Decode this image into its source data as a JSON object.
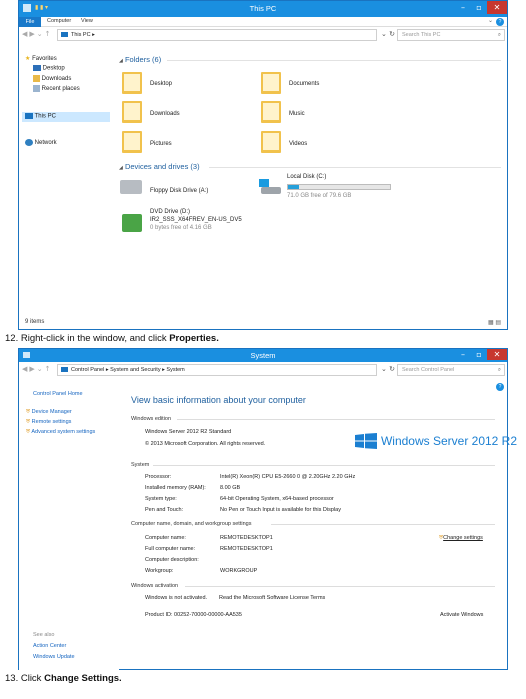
{
  "explorer": {
    "title": "This PC",
    "ribbon_tabs": [
      "File",
      "Computer",
      "View"
    ],
    "address": "This PC ▸",
    "search_placeholder": "Search This PC",
    "nav": {
      "favorites": "Favorites",
      "desktop": "Desktop",
      "downloads": "Downloads",
      "recent": "Recent places",
      "thispc": "This PC",
      "network": "Network"
    },
    "folders_header": "Folders (6)",
    "folders": [
      "Desktop",
      "Documents",
      "Downloads",
      "Music",
      "Pictures",
      "Videos"
    ],
    "devices_header": "Devices and drives (3)",
    "floppy": "Floppy Disk Drive (A:)",
    "localdisk": "Local Disk (C:)",
    "localdisk_free": "71.0 GB free of 79.6 GB",
    "localdisk_used_fraction": 0.11,
    "dvd_name": "DVD Drive (D:)",
    "dvd_label": "IR2_SSS_X64FREV_EN-US_DV5",
    "dvd_free": "0 bytes free of 4.16 GB",
    "status": "9 items"
  },
  "step12": {
    "prefix": "12. Right-click in the window, and click ",
    "bold": "Properties."
  },
  "step13": {
    "prefix": "13. Click ",
    "bold": "Change Settings."
  },
  "system": {
    "title": "System",
    "address": "Control Panel ▸ System and Security ▸ System",
    "search_placeholder": "Search Control Panel",
    "side": {
      "home": "Control Panel Home",
      "device_manager": "Device Manager",
      "remote": "Remote settings",
      "advanced": "Advanced system settings",
      "see_also": "See also",
      "action_center": "Action Center",
      "windows_update": "Windows Update"
    },
    "heading": "View basic information about your computer",
    "edition_header": "Windows edition",
    "edition": "Windows Server 2012 R2 Standard",
    "copyright": "© 2013 Microsoft Corporation. All rights reserved.",
    "logo_text": "Windows Server 2012 R2",
    "system_header": "System",
    "rows": [
      {
        "label": "Processor:",
        "value": "Intel(R) Xeon(R) CPU E5-2660 0 @ 2.20GHz  2.20 GHz"
      },
      {
        "label": "Installed memory (RAM):",
        "value": "8.00 GB"
      },
      {
        "label": "System type:",
        "value": "64-bit Operating System, x64-based processor"
      },
      {
        "label": "Pen and Touch:",
        "value": "No Pen or Touch Input is available for this Display"
      }
    ],
    "name_header": "Computer name, domain, and workgroup settings",
    "name_rows": [
      {
        "label": "Computer name:",
        "value": "REMOTEDESKTOP1"
      },
      {
        "label": "Full computer name:",
        "value": "REMOTEDESKTOP1"
      },
      {
        "label": "Computer description:",
        "value": ""
      },
      {
        "label": "Workgroup:",
        "value": "WORKGROUP"
      }
    ],
    "change_settings": "Change settings",
    "activation_header": "Windows activation",
    "activation_status": "Windows is not activated.",
    "license_link": "Read the Microsoft Software License Terms",
    "product_id": "Product ID: 00252-70000-00000-AA535",
    "activate": "Activate Windows"
  },
  "colors": {
    "accent": "#1a8fe0",
    "link": "#1565c0",
    "close": "#c7372f",
    "logo": "#1b7fd1"
  }
}
